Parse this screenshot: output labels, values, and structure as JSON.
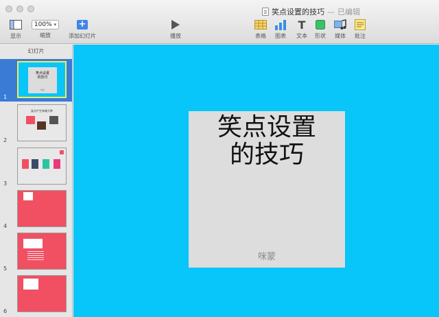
{
  "window": {
    "title": "笑点设置的技巧",
    "separator": "—",
    "status": "已编辑"
  },
  "toolbar": {
    "view_label": "显示",
    "zoom_value": "100%",
    "zoom_label": "缩放",
    "add_slide_label": "添加幻灯片",
    "add_slide_symbol": "+",
    "play_label": "播放",
    "table_label": "表格",
    "chart_label": "图表",
    "text_label": "文本",
    "text_symbol": "T",
    "shape_label": "形状",
    "media_label": "媒体",
    "comment_label": "批注"
  },
  "sidebar": {
    "header": "幻灯片",
    "slides": [
      {
        "number": "1",
        "thumb_title": "笑点设置的技巧",
        "thumb_sub": "咪蒙"
      },
      {
        "number": "2",
        "thumb_title": "笑点产生有哪几种"
      },
      {
        "number": "3"
      },
      {
        "number": "4"
      },
      {
        "number": "5"
      },
      {
        "number": "6"
      }
    ]
  },
  "slide": {
    "title": "笑点设置的技巧",
    "subtitle": "咪蒙"
  },
  "colors": {
    "canvas_background": "#08c6f9",
    "selection": "#3a7bd5",
    "selection_border": "#f4ec5a",
    "accent_red": "#f05062"
  }
}
